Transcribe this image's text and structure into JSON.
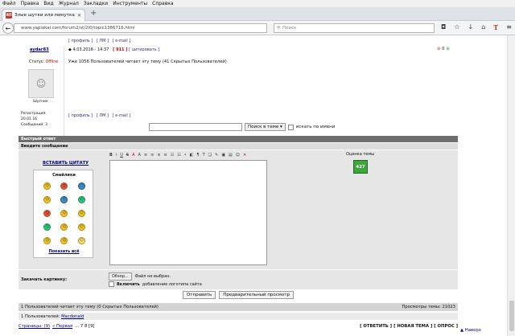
{
  "menu": [
    "Файл",
    "Правка",
    "Вид",
    "Журнал",
    "Закладки",
    "Инструменты",
    "Справка"
  ],
  "browser": {
    "tab_title": "Злые шутки или минутка ...",
    "favicon_text": "ЯП",
    "url": "www.yaplakal.com/forum2/st/2I0/topic1386716.html",
    "search_placeholder": "Поиск"
  },
  "post": {
    "links_top": [
      "[ профиль ]",
      "[ ЛМ ]",
      "[ e-mail ]"
    ],
    "links_bottom": [
      "[ профиль ]",
      "[ ЛМ ]",
      "[ e-mail ]"
    ],
    "username": "aydar83",
    "date": "4.03.2016 - 14:37",
    "post_num": "[ 911 ]",
    "quote_link": "[ цитировать ]",
    "text": "Уже 1056 Пользователей читает эту тему (41 Скрытых Пользователей)",
    "status_label": "Статус:",
    "status_value": "Offline",
    "avatar_text": "Нет аватара",
    "rank": "Шутник",
    "registered": "Регистрация: 20.01.16",
    "posts": "Сообщений: 3",
    "rating_value": "0"
  },
  "search": {
    "button": "Поиск в теме",
    "checkbox_label": "искать по имени"
  },
  "reply": {
    "title": "Быстрый ответ",
    "message_label": "Введите сообщение",
    "quote_link": "ВСТАВИТЬ ЦИТАТУ",
    "smilies_title": "Смайлики",
    "show_all": "Показать всё",
    "toolbar": [
      "B",
      "i",
      "U",
      "S",
      "A",
      "A",
      "≡",
      "≡",
      "≡",
      "≡",
      "☷",
      "☷",
      "•",
      "◧",
      "¶",
      "T",
      "❏",
      "✎",
      "▣",
      "▤",
      "☺",
      "✕"
    ],
    "rating_title": "Оценка темы",
    "rating_value": "427",
    "upload_label": "Закачать картинку:",
    "browse_button": "Обзор...",
    "file_status": "Файл не выбран.",
    "logo_bold": "Включить",
    "logo_text": "добавление логотипа сайта",
    "send_button": "Отправить",
    "preview_button": "Предварительный просмотр"
  },
  "footer": {
    "readers_text": "1 Пользователей читает эту тему (0 Скрытых Пользователей)",
    "views_text": "Просмотры темы: 21023",
    "users_prefix": "1 Пользователей: ",
    "user_name": "Macdonald",
    "pages_label": "Страницы: (9)",
    "pages_first": "« Первая",
    "pages_rest": "... 7 8 [9]",
    "answer": "[ ОТВЕТИТЬ ]",
    "new_topic": "[ НОВАЯ ТЕМА ]",
    "poll": "[ ОПРОС ]",
    "up": "▲ Наверх"
  }
}
